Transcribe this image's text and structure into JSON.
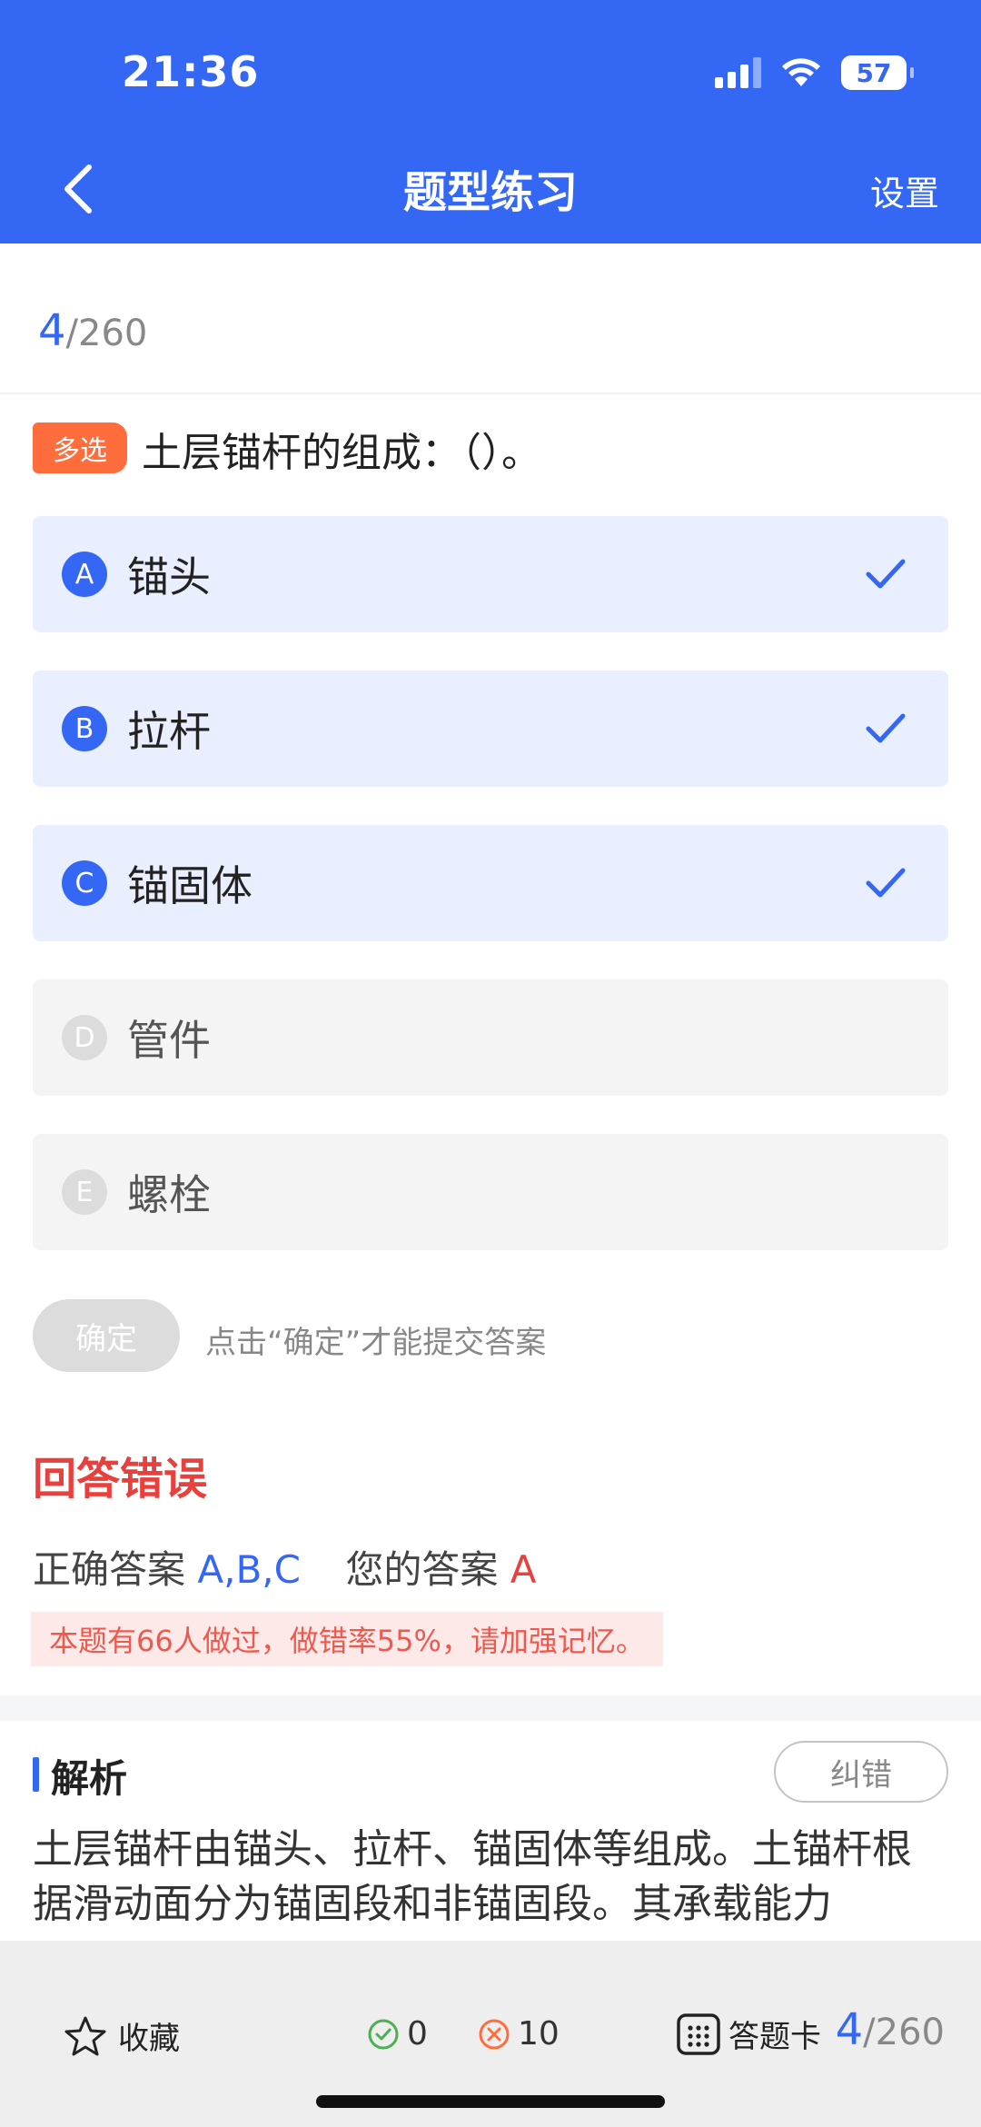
{
  "status_bar": {
    "time": "21:36",
    "battery": "57"
  },
  "nav": {
    "title": "题型练习",
    "settings_label": "设置"
  },
  "progress": {
    "current": "4",
    "total": "/260"
  },
  "question": {
    "type_badge": "多选",
    "text": "土层锚杆的组成：（）。",
    "options": [
      {
        "letter": "A",
        "text": "锚头",
        "selected": true
      },
      {
        "letter": "B",
        "text": "拉杆",
        "selected": true
      },
      {
        "letter": "C",
        "text": "锚固体",
        "selected": true
      },
      {
        "letter": "D",
        "text": "管件",
        "selected": false
      },
      {
        "letter": "E",
        "text": "螺栓",
        "selected": false
      }
    ]
  },
  "submit": {
    "button_label": "确定",
    "hint": "点击“确定”才能提交答案"
  },
  "result": {
    "title": "回答错误",
    "correct_label": "正确答案",
    "correct_answer": "A,B,C",
    "your_label": "您的答案",
    "your_answer": "A",
    "warning": "本题有66人做过，做错率55%，请加强记忆。"
  },
  "analysis": {
    "title": "解析",
    "report_button": "纠错",
    "text": "土层锚杆由锚头、拉杆、锚固体等组成。土锚杆根据滑动面分为锚固段和非锚固段。其承载能力"
  },
  "bottom_bar": {
    "favorite_label": "收藏",
    "correct_count": "0",
    "wrong_count": "10",
    "answer_card_label": "答题卡",
    "progress_current": "4",
    "progress_total": "/260"
  },
  "colors": {
    "primary": "#3468f4",
    "error": "#e8403c",
    "badge": "#ff6d3d",
    "success": "#4caf50"
  }
}
